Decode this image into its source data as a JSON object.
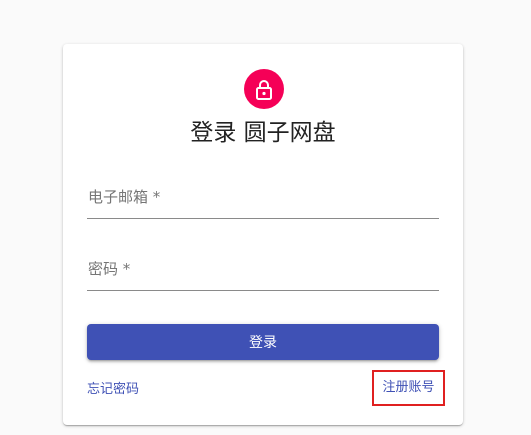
{
  "login": {
    "title": "登录 圆子网盘",
    "email_label": "电子邮箱 *",
    "email_value": "",
    "password_label": "密码 *",
    "password_value": "",
    "submit_label": "登录",
    "forgot_link": "忘记密码",
    "register_link": "注册账号",
    "lock_icon": "lock-icon"
  },
  "colors": {
    "avatar": "#f50057",
    "primary": "#3f51b5",
    "highlight_box": "#e02020"
  }
}
